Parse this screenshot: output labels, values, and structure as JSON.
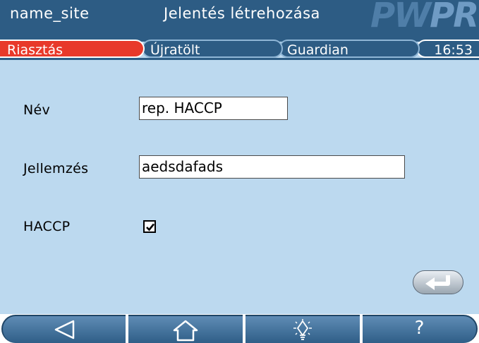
{
  "header": {
    "site_name": "name_site",
    "title": "Jelentés létrehozása",
    "logo_text_a": "PW",
    "logo_text_b": "PRO"
  },
  "tabs": [
    {
      "label": "Riasztás",
      "active": true
    },
    {
      "label": "Újratölt",
      "active": false
    },
    {
      "label": "Guardian",
      "active": false
    }
  ],
  "clock": "16:53",
  "form": {
    "name_label": "Név",
    "name_value": "rep. HACCP",
    "desc_label": "Jellemzés",
    "desc_value": "aedsdafads",
    "haccp_label": "HACCP",
    "haccp_checked": true
  },
  "nav": {
    "back_icon": "back-triangle-icon",
    "home_icon": "home-icon",
    "light_icon": "light-icon",
    "help_label": "?"
  },
  "colors": {
    "titlebar": "#2d5c84",
    "background": "#bcd9ef",
    "active_tab": "#e8392a"
  }
}
